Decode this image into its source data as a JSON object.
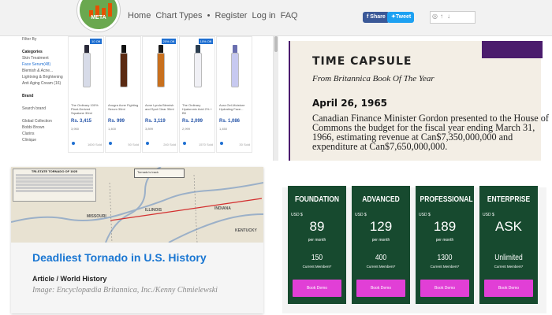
{
  "header": {
    "logo_text": "META",
    "logo_subtext": "",
    "nav": [
      "Home",
      "Chart Types",
      "•",
      "Register",
      "Log in",
      "FAQ"
    ],
    "share_facebook": "Share",
    "share_twitter": "Tweet"
  },
  "shop": {
    "filters": [
      "Filter By",
      "",
      "Categories",
      "Skin Treatment",
      "Face Serum(48)",
      "Blemish & Acne...",
      "Lightning & Brightening...",
      "Anti Aging Cream (16)",
      "",
      "Brand",
      "",
      "Search brand",
      "",
      "Global Collection",
      "Bobbi Brown",
      "Clarins",
      "Clinique"
    ],
    "products": [
      {
        "badge": "10 Off",
        "name": "The Ordinary 100% Plant-Derived Squalane 30ml",
        "price": "Rs. 3,415",
        "old": "3,950",
        "sold": "1600 Sold",
        "color": "#d7dbe8",
        "cap": "#2a2a3a"
      },
      {
        "badge": "",
        "name": "Anugra Acne Fighting Serum 30ml",
        "price": "Rs. 999",
        "old": "1,400",
        "sold": "50 Sold",
        "color": "#5a2a12",
        "cap": "#111"
      },
      {
        "badge": "20% Off",
        "name": "Acne Lynda Blemish and Spot Clear 30ml",
        "price": "Rs. 3,119",
        "old": "3,899",
        "sold": "240 Sold",
        "color": "#c8701e",
        "cap": "#1a1a1a"
      },
      {
        "badge": "10% Off",
        "name": "The Ordinary Hyaluronic Acid 2% + B5",
        "price": "Rs. 2,099",
        "old": "2,999",
        "sold": "1570 Sold",
        "color": "#f0f0f5",
        "cap": "#2c3e50"
      },
      {
        "badge": "",
        "name": "Aura Gel-Moisture Hydrating Face...",
        "price": "Rs. 1,086",
        "old": "1,450",
        "sold": "30 Sold",
        "color": "#c7c9f0",
        "cap": "#6a6fb0"
      }
    ]
  },
  "time_capsule": {
    "title": "TIME CAPSULE",
    "subtitle": "From Britannica Book Of The Year",
    "date": "April 26, 1965",
    "body": "Canadian Finance Minister Gordon presented to the House of Commons the budget for the fiscal year ending March 31, 1966, estimating revenue at Can$7,350,000,000 and expenditure at Can$7,650,000,000."
  },
  "tornado": {
    "inset_title": "TRI-STATE TORNADO OF 1925",
    "legend_text": "Tornado's track",
    "states": [
      "MISSOURI",
      "ILLINOIS",
      "INDIANA",
      "KENTUCKY"
    ],
    "title": "Deadliest Tornado in U.S. History",
    "subtitle": "Article / World History",
    "caption": "Image: Encyclopædia Britannica, Inc./Kenny Chmielewski"
  },
  "pricing": {
    "plans": [
      {
        "name": "FOUNDATION",
        "currency": "USD $",
        "amount": "89",
        "period": "per month",
        "members": "150",
        "members_label": "Current Members*",
        "button": "Book Demo"
      },
      {
        "name": "ADVANCED",
        "currency": "USD $",
        "amount": "129",
        "period": "per month",
        "members": "400",
        "members_label": "Current Members*",
        "button": "Book Demo"
      },
      {
        "name": "PROFESSIONAL",
        "currency": "USD $",
        "amount": "189",
        "period": "per month",
        "members": "1300",
        "members_label": "Current Members*",
        "button": "Book Demo"
      },
      {
        "name": "ENTERPRISE",
        "currency": "USD $",
        "amount": "ASK",
        "period": "",
        "members": "Unlimited",
        "members_label": "Current Members*",
        "button": "Book Demo"
      }
    ]
  }
}
